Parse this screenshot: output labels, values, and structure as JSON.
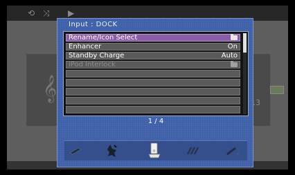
{
  "dialog": {
    "title": "Input : DOCK",
    "items": [
      {
        "label": "Rename/Icon Select",
        "value": "",
        "icon": "folder-icon",
        "selected": true,
        "enabled": true
      },
      {
        "label": "Enhancer",
        "value": "On",
        "selected": false,
        "enabled": true
      },
      {
        "label": "Standby Charge",
        "value": "Auto",
        "selected": false,
        "enabled": true
      },
      {
        "label": "iPod Interlock",
        "value": "",
        "icon": "folder-icon",
        "selected": false,
        "enabled": false
      }
    ],
    "page_indicator": "1 / 4",
    "tabs": [
      {
        "name": "tab-input-settings",
        "icon": "device-icon"
      },
      {
        "name": "tab-speaker",
        "icon": "speaker-icon"
      },
      {
        "name": "tab-dock",
        "icon": "dock-icon",
        "active": true
      },
      {
        "name": "tab-video",
        "icon": "video-icon"
      },
      {
        "name": "tab-tools",
        "icon": "tools-icon"
      }
    ]
  },
  "background": {
    "track_number": "13"
  }
}
